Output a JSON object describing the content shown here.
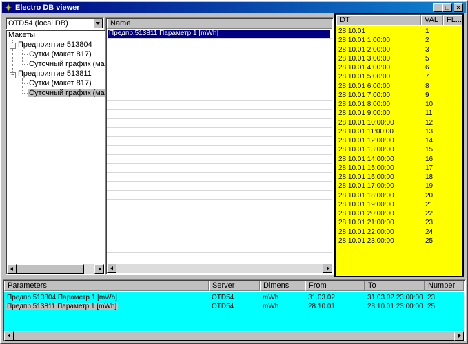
{
  "window": {
    "title": "Electro DB viewer"
  },
  "colors": {
    "data_bg": "#ffff00",
    "params_bg": "#00ffff",
    "selection": "#000080"
  },
  "left": {
    "db_combo": "OTD54 (local DB)",
    "tree": {
      "root": "Макеты",
      "nodes": [
        {
          "label": "Предприятие 513804",
          "children": [
            "Сутки (макет 817)",
            "Суточный график (ма"
          ]
        },
        {
          "label": "Предприятие 513811",
          "children": [
            "Сутки (макет 817)",
            "Суточный график (ма"
          ]
        }
      ]
    }
  },
  "middle": {
    "header": "Name",
    "selected_item": "Предпр.513811 Параметр 1 [mWh]"
  },
  "right": {
    "headers": [
      "DT",
      "VAL",
      "FL..."
    ],
    "rows": [
      [
        "28.10.01",
        "1"
      ],
      [
        "28.10.01 1:00:00",
        "2"
      ],
      [
        "28.10.01 2:00:00",
        "3"
      ],
      [
        "28.10.01 3:00:00",
        "5"
      ],
      [
        "28.10.01 4:00:00",
        "6"
      ],
      [
        "28.10.01 5:00:00",
        "7"
      ],
      [
        "28.10.01 6:00:00",
        "8"
      ],
      [
        "28.10.01 7:00:00",
        "9"
      ],
      [
        "28.10.01 8:00:00",
        "10"
      ],
      [
        "28.10.01 9:00:00",
        "11"
      ],
      [
        "28.10.01 10:00:00",
        "12"
      ],
      [
        "28.10.01 11:00:00",
        "13"
      ],
      [
        "28.10.01 12:00:00",
        "14"
      ],
      [
        "28.10.01 13:00:00",
        "15"
      ],
      [
        "28.10.01 14:00:00",
        "16"
      ],
      [
        "28.10.01 15:00:00",
        "17"
      ],
      [
        "28.10.01 16:00:00",
        "18"
      ],
      [
        "28.10.01 17:00:00",
        "19"
      ],
      [
        "28.10.01 18:00:00",
        "20"
      ],
      [
        "28.10.01 19:00:00",
        "21"
      ],
      [
        "28.10.01 20:00:00",
        "22"
      ],
      [
        "28.10.01 21:00:00",
        "23"
      ],
      [
        "28.10.01 22:00:00",
        "24"
      ],
      [
        "28.10.01 23:00:00",
        "25"
      ]
    ]
  },
  "bottom": {
    "headers": [
      "Parameters",
      "Server",
      "Dimens",
      "From",
      "To",
      "Number"
    ],
    "rows": [
      [
        "Предпр.513804 Параметр 1 [mWh]",
        "OTD54",
        "mWh",
        "31.03.02",
        "31.03.02 23:00:00",
        "23"
      ],
      [
        "Предпр.513811 Параметр 1 [mWh]",
        "OTD54",
        "mWh",
        "28.10.01",
        "28.10.01 23:00:00",
        "25"
      ]
    ]
  }
}
